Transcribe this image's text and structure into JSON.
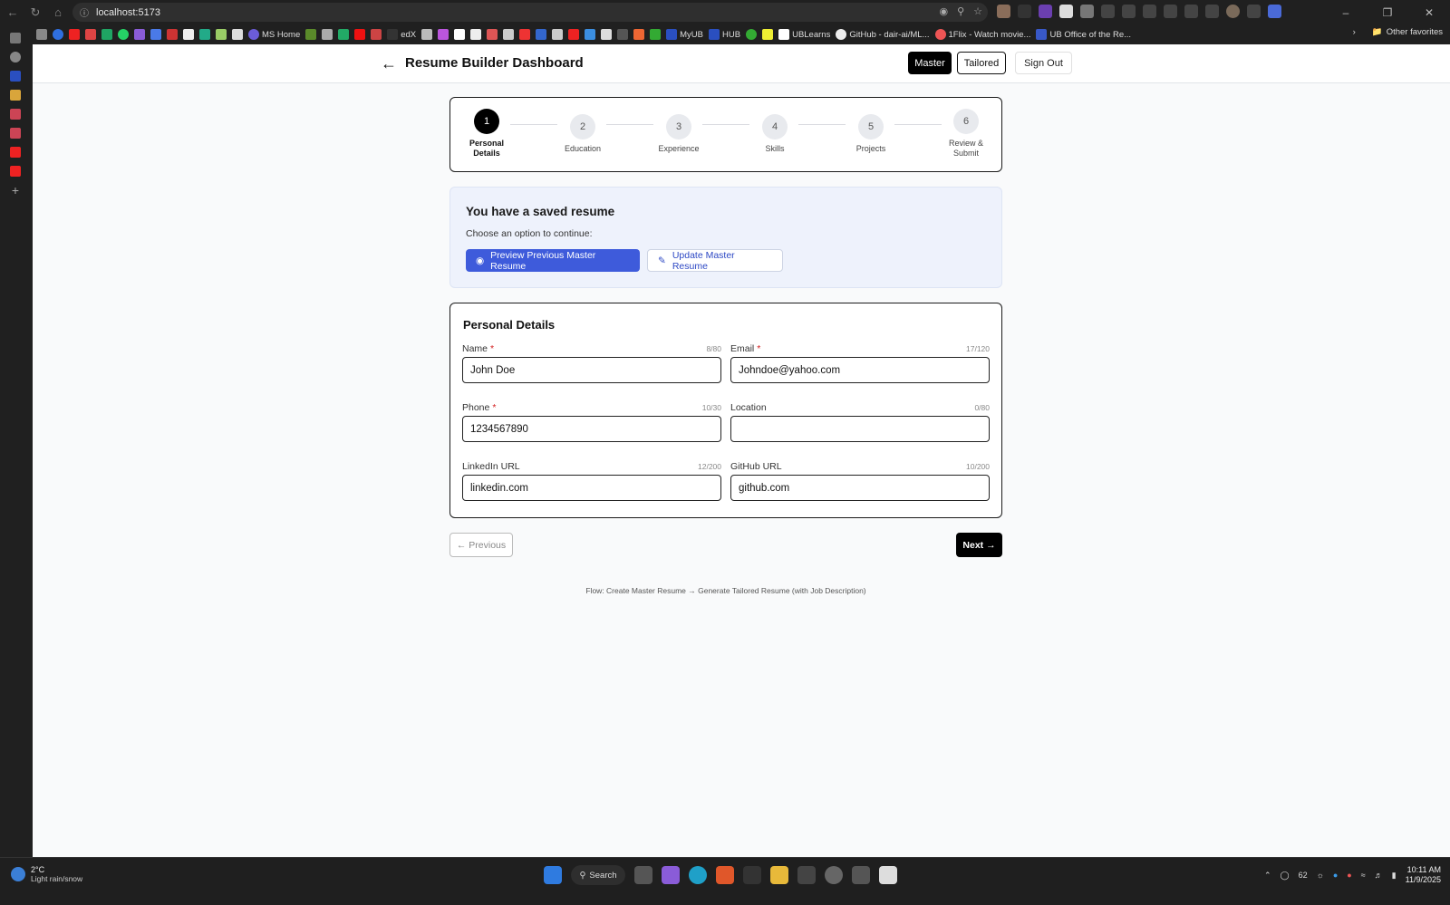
{
  "browser": {
    "url": "localhost:5173",
    "bookmarks": [
      "MS Home",
      "edX",
      "MyUB",
      "HUB",
      "UBLearns",
      "GitHub - dair-ai/ML...",
      "1Flix - Watch movie...",
      "UB Office of the Re..."
    ],
    "other_favorites": "Other favorites"
  },
  "header": {
    "title": "Resume Builder Dashboard",
    "master_label": "Master",
    "tailored_label": "Tailored",
    "signout_label": "Sign Out"
  },
  "steps": [
    {
      "num": "1",
      "label": "Personal Details"
    },
    {
      "num": "2",
      "label": "Education"
    },
    {
      "num": "3",
      "label": "Experience"
    },
    {
      "num": "4",
      "label": "Skills"
    },
    {
      "num": "5",
      "label": "Projects"
    },
    {
      "num": "6",
      "label": "Review & Submit"
    }
  ],
  "saved": {
    "heading": "You have a saved resume",
    "subtext": "Choose an option to continue:",
    "preview_label": "Preview Previous Master Resume",
    "update_label": "Update Master Resume"
  },
  "personal": {
    "heading": "Personal Details",
    "name": {
      "label": "Name",
      "count": "8/80",
      "value": "John Doe"
    },
    "email": {
      "label": "Email",
      "count": "17/120",
      "value": "Johndoe@yahoo.com"
    },
    "phone": {
      "label": "Phone",
      "count": "10/30",
      "value": "1234567890"
    },
    "location": {
      "label": "Location",
      "count": "0/80",
      "value": ""
    },
    "linkedin": {
      "label": "LinkedIn URL",
      "count": "12/200",
      "value": "linkedin.com"
    },
    "github": {
      "label": "GitHub URL",
      "count": "10/200",
      "value": "github.com"
    }
  },
  "nav": {
    "prev_label": "← Previous",
    "next_label": "Next →"
  },
  "flow_note": "Flow: Create Master Resume → Generate Tailored Resume (with Job Description)",
  "taskbar": {
    "temp": "2°C",
    "weather": "Light rain/snow",
    "search": "Search",
    "battery": "62",
    "time": "10:11 AM",
    "date": "11/9/2025"
  },
  "colors": {
    "accent": "#3e5bdb",
    "required": "#d32020"
  }
}
